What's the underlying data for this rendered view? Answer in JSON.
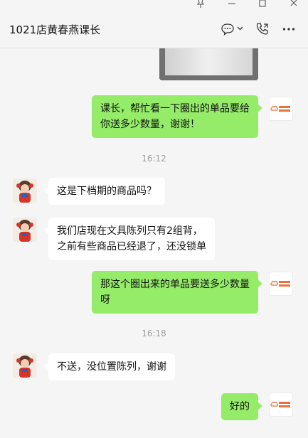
{
  "window": {
    "pin_glyph": "⚲",
    "min_glyph": "—",
    "max_glyph": "☐",
    "close_glyph": "✕"
  },
  "header": {
    "title": "1021店黄春燕课长"
  },
  "messages": [
    {
      "type": "image",
      "side": "right"
    },
    {
      "type": "text",
      "side": "right",
      "lines": [
        "课长，帮忙看一下圈出的单品要给",
        "你送多少数量，谢谢！"
      ]
    },
    {
      "type": "time",
      "text": "16:12"
    },
    {
      "type": "text",
      "side": "left",
      "text": "这是下档期的商品吗？"
    },
    {
      "type": "text",
      "side": "left",
      "lines": [
        "我们店现在文具陈列只有2组背，",
        "之前有些商品已经退了，还没锁单"
      ]
    },
    {
      "type": "text",
      "side": "right",
      "lines": [
        "那这个圈出来的单品要送多少数量",
        "呀"
      ]
    },
    {
      "type": "time",
      "text": "16:18"
    },
    {
      "type": "text",
      "side": "left",
      "text": "不送，没位置陈列，谢谢"
    },
    {
      "type": "text",
      "side": "right",
      "text": "好的"
    }
  ],
  "colors": {
    "my_bubble": "#95ec69",
    "their_bubble": "#ffffff",
    "background": "#f5f5f5",
    "logo_orange": "#e8733a"
  }
}
